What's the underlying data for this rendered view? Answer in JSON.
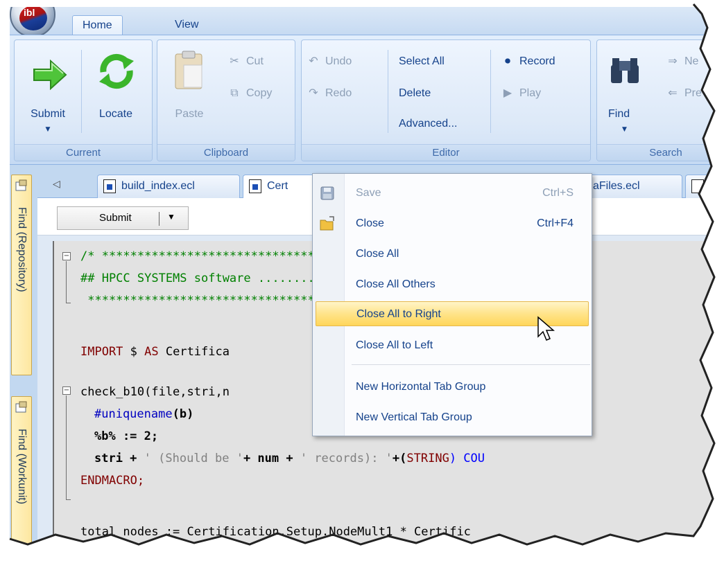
{
  "app": {
    "orb_text": "ibl"
  },
  "ribbon_tabs": [
    {
      "label": "Home",
      "active": true
    },
    {
      "label": "View",
      "active": false
    }
  ],
  "groups": {
    "current": {
      "label": "Current",
      "submit": "Submit",
      "locate": "Locate"
    },
    "clipboard": {
      "label": "Clipboard",
      "paste": "Paste",
      "cut": "Cut",
      "copy": "Copy"
    },
    "editor": {
      "label": "Editor",
      "undo": "Undo",
      "redo": "Redo",
      "select_all": "Select All",
      "delete": "Delete",
      "advanced": "Advanced...",
      "record": "Record",
      "play": "Play"
    },
    "search": {
      "label": "Search",
      "find": "Find",
      "next": "Ne",
      "prev": "Pre"
    }
  },
  "side_panels": [
    {
      "label": "Find (Repository)"
    },
    {
      "label": "Find (Workunit)"
    }
  ],
  "doc_tabs": [
    {
      "label": "build_index.ecl"
    },
    {
      "label": "Cert"
    },
    {
      "label": "aFiles.ecl"
    }
  ],
  "editor_toolbar": {
    "submit": "Submit"
  },
  "code": {
    "line1": "/* ***************************************************************",
    "line2": "## HPCC SYSTEMS software ....................... HPCC SystemsA",
    "line3": " *****************************************************************",
    "import_kw": "IMPORT",
    "import_rest": " $ ",
    "import_as": "AS",
    "import_name": " Certifica",
    "macro_sig": "check_b10(file,stri,n",
    "uniq_dir": "#uniquename",
    "uniq_arg": "(b)",
    "assign": "%b% := 2;",
    "stri_start": "stri + ",
    "stri_str1": "' (Should be '",
    "stri_mid": "+ num + ",
    "stri_str2": "' records): '",
    "stri_plus": "+(",
    "stri_type": "STRING",
    "stri_end": ") COU",
    "endmacro": "ENDMACRO;",
    "last_line": "total_nodes := Certification.Setup.NodeMult1 * Certific"
  },
  "context_menu": {
    "items": [
      {
        "label": "Save",
        "shortcut": "Ctrl+S",
        "disabled": true
      },
      {
        "label": "Close",
        "shortcut": "Ctrl+F4",
        "disabled": false
      },
      {
        "label": "Close All",
        "shortcut": "",
        "disabled": false
      },
      {
        "label": "Close All Others",
        "shortcut": "",
        "disabled": false
      },
      {
        "label": "Close All to Right",
        "shortcut": "",
        "disabled": false,
        "highlighted": true
      },
      {
        "label": "Close All to Left",
        "shortcut": "",
        "disabled": false
      },
      {
        "label": "New Horizontal Tab Group",
        "shortcut": "",
        "disabled": false
      },
      {
        "label": "New Vertical Tab Group",
        "shortcut": "",
        "disabled": false
      }
    ]
  },
  "colors": {
    "ribbon_text": "#15428b",
    "highlight": "#ffe48a",
    "comment": "#008000",
    "keyword": "#800000"
  }
}
